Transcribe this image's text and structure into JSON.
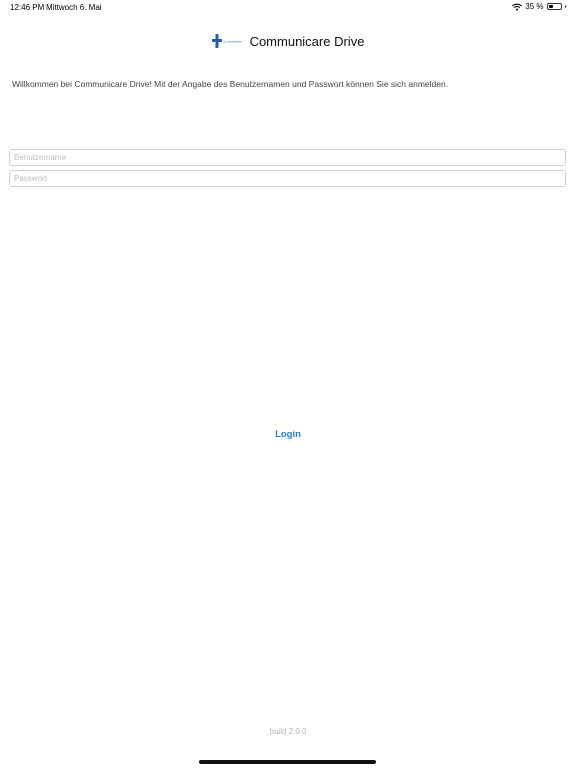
{
  "status_bar": {
    "time": "12:46 PM",
    "date": "Mittwoch 6. Mai",
    "battery_text": "35 %",
    "battery_level": 0.35
  },
  "header": {
    "logo_icon": "cross-logo",
    "logo_caption": "Communicare",
    "title": "Communicare Drive",
    "brand_color": "#2b5ea8"
  },
  "welcome_text": "Willkommen bei Communicare Drive! Mit der Angabe des Benutzernamen und Passwort können Sie sich anmelden.",
  "form": {
    "username_placeholder": "Benutzername",
    "password_placeholder": "Passwort",
    "login_label": "Login",
    "accent_color": "#1f7bd8"
  },
  "build": "build 2.0.0"
}
